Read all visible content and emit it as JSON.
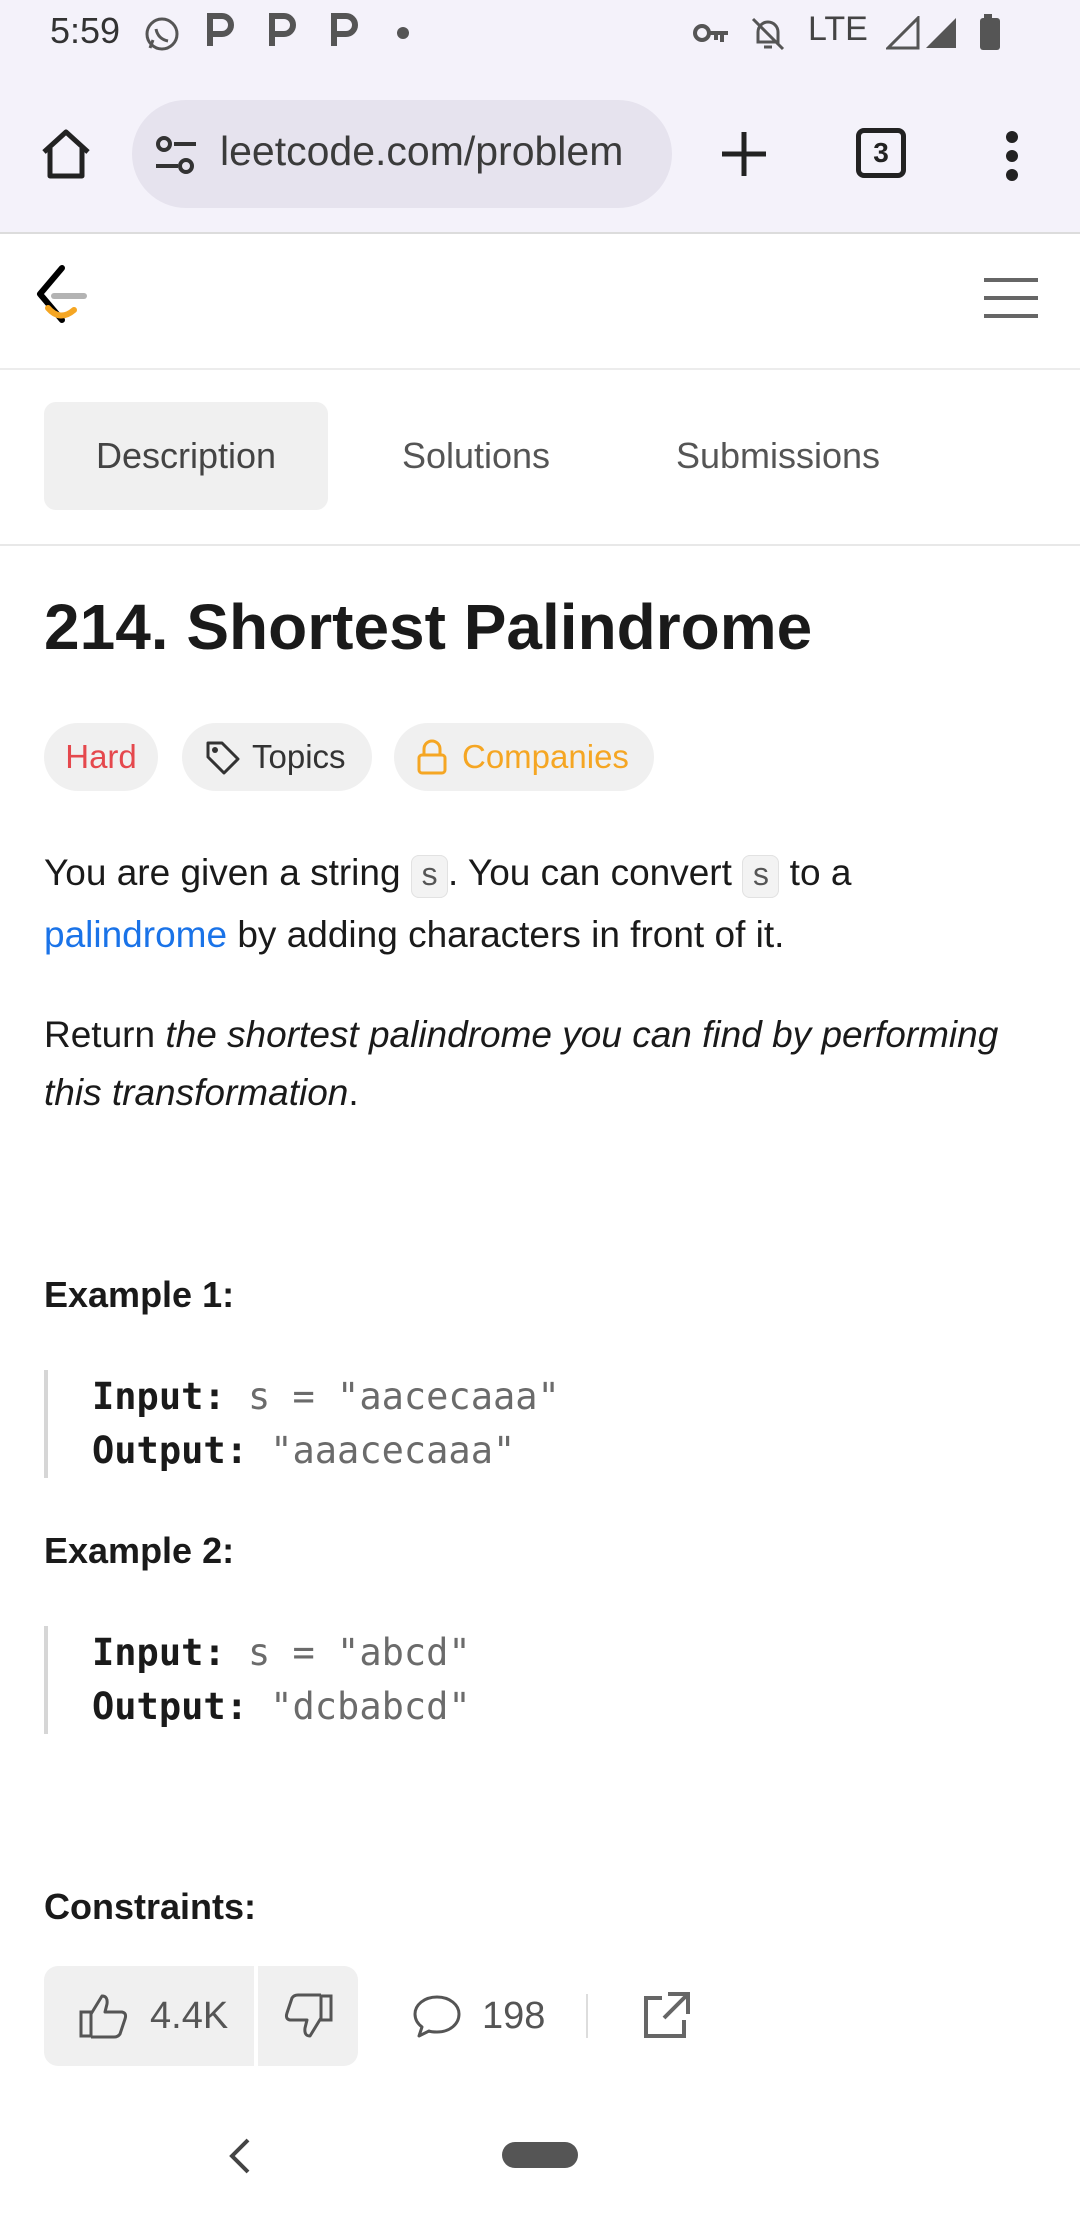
{
  "status_bar": {
    "time": "5:59",
    "network": "LTE",
    "icons": [
      "whatsapp-icon",
      "p-icon",
      "p-icon",
      "p-icon",
      "dot-icon",
      "key-icon",
      "bell-off-icon",
      "signal-icon",
      "signal-icon",
      "battery-icon"
    ]
  },
  "browser": {
    "url": "leetcode.com/problem",
    "tab_count": "3",
    "icons": [
      "home-icon",
      "site-settings-icon",
      "new-tab-icon",
      "tab-switcher-icon",
      "more-menu-icon"
    ]
  },
  "site_header": {
    "icons": [
      "leetcode-logo",
      "hamburger-menu-icon"
    ]
  },
  "tabs": [
    {
      "label": "Description",
      "active": true
    },
    {
      "label": "Solutions",
      "active": false
    },
    {
      "label": "Submissions",
      "active": false
    }
  ],
  "problem": {
    "title": "214. Shortest Palindrome",
    "difficulty": "Hard",
    "topics_label": "Topics",
    "companies_label": "Companies",
    "description": {
      "p1_part1": "You are given a string ",
      "p1_code1": "s",
      "p1_part2": ". You can convert ",
      "p1_code2": "s",
      "p1_part3": " to a ",
      "p1_link": "palindrome",
      "p1_part4": " by adding characters in front of it.",
      "p2_part1": "Return ",
      "p2_italic": "the shortest palindrome you can find by performing this transformation",
      "p2_part2": "."
    },
    "examples": [
      {
        "heading": "Example 1:",
        "input_label": "Input:",
        "input_value": "s = \"aacecaaa\"",
        "output_label": "Output:",
        "output_value": "\"aaacecaaa\""
      },
      {
        "heading": "Example 2:",
        "input_label": "Input:",
        "input_value": "s = \"abcd\"",
        "output_label": "Output:",
        "output_value": "\"dcbabcd\""
      }
    ],
    "constraints_heading": "Constraints:"
  },
  "actions": {
    "likes": "4.4K",
    "comments": "198"
  },
  "colors": {
    "hard": "#e5484d",
    "companies": "#f5a623",
    "link": "#1a73e8"
  }
}
